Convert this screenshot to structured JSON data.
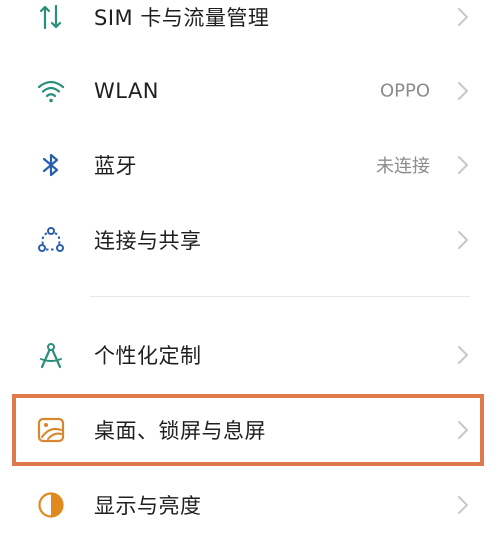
{
  "accent_color": "#2a8f7a",
  "highlight_color": "#e07a4b",
  "settings": {
    "items": [
      {
        "label": "SIM 卡与流量管理",
        "value": "",
        "icon": "sim-data-icon"
      },
      {
        "label": "WLAN",
        "value": "OPPO",
        "icon": "wifi-icon"
      },
      {
        "label": "蓝牙",
        "value": "未连接",
        "icon": "bluetooth-icon"
      },
      {
        "label": "连接与共享",
        "value": "",
        "icon": "share-icon"
      },
      {
        "label": "个性化定制",
        "value": "",
        "icon": "personalization-icon"
      },
      {
        "label": "桌面、锁屏与息屏",
        "value": "",
        "icon": "wallpaper-icon"
      },
      {
        "label": "显示与亮度",
        "value": "",
        "icon": "display-brightness-icon"
      }
    ]
  }
}
